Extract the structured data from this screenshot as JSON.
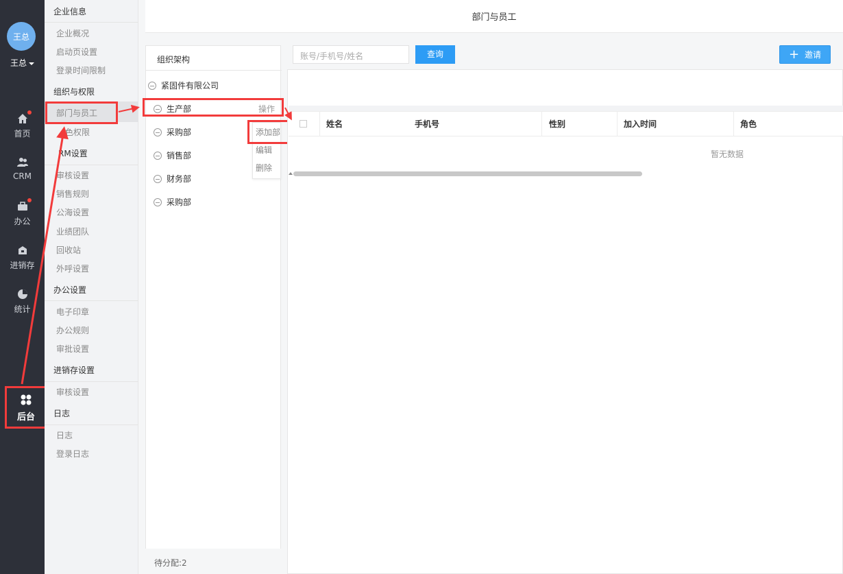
{
  "user": {
    "avatar_text": "王总",
    "name": "王总"
  },
  "leftnav": {
    "items": [
      {
        "label": "首页",
        "icon": "home-icon"
      },
      {
        "label": "CRM",
        "icon": "users-icon"
      },
      {
        "label": "办公",
        "icon": "briefcase-icon"
      },
      {
        "label": "进销存",
        "icon": "warehouse-icon"
      },
      {
        "label": "统计",
        "icon": "pie-chart-icon"
      },
      {
        "label": "后台",
        "icon": "grid-icon"
      }
    ]
  },
  "submenu": {
    "sections": [
      {
        "title": "企业信息",
        "items": [
          "企业概况",
          "启动页设置",
          "登录时间限制"
        ]
      },
      {
        "title": "组织与权限",
        "items": [
          "部门与员工",
          "色权限"
        ]
      },
      {
        "title": "RM设置",
        "items": [
          "审核设置",
          "销售规则",
          "公海设置",
          "业绩团队",
          "回收站",
          "外呼设置"
        ]
      },
      {
        "title": "办公设置",
        "items": [
          "电子印章",
          "办公规则",
          "审批设置"
        ]
      },
      {
        "title": "进销存设置",
        "items": [
          "审核设置"
        ]
      },
      {
        "title": "日志",
        "items": [
          "日志",
          "登录日志"
        ]
      }
    ]
  },
  "header": {
    "title": "部门与员工"
  },
  "org": {
    "title": "组织架构",
    "company": "紧固件有限公司",
    "departments": [
      "生产部",
      "采购部",
      "销售部",
      "财务部",
      "采购部"
    ],
    "operate_label": "操作",
    "menu": [
      "添加部",
      "编辑",
      "删除"
    ],
    "pending": "待分配:2"
  },
  "search": {
    "placeholder": "账号/手机号/姓名",
    "button": "查询"
  },
  "invite": {
    "label": "邀请"
  },
  "table": {
    "columns": [
      "姓名",
      "手机号",
      "性别",
      "加入时间",
      "角色"
    ],
    "empty_text": "暂无数据"
  },
  "colors": {
    "accent": "#2d9cf5",
    "highlight": "#f23b3b",
    "nav_bg": "#2d3039"
  }
}
